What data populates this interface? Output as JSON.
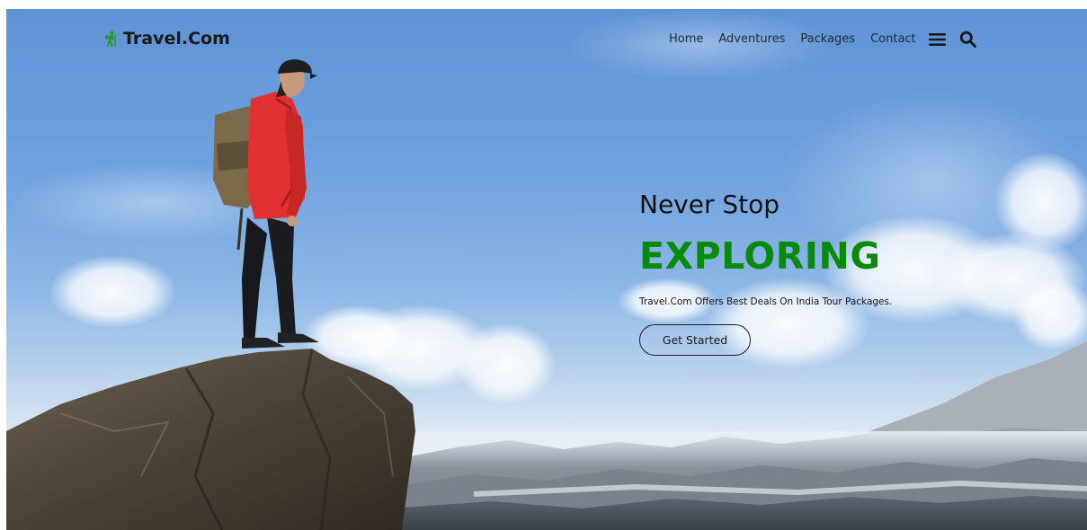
{
  "brand": {
    "name": "Travel.Com",
    "icon": "hiker-icon",
    "icon_color": "#1f9d1f"
  },
  "nav": {
    "items": [
      {
        "label": "Home"
      },
      {
        "label": "Adventures"
      },
      {
        "label": "Packages"
      },
      {
        "label": "Contact"
      }
    ],
    "menu_icon": "hamburger-icon",
    "search_icon": "search-icon"
  },
  "hero": {
    "subtitle": "Never Stop",
    "title": "EXPLORING",
    "description": "Travel.Com Offers Best Deals On India Tour Packages.",
    "cta_label": "Get Started"
  },
  "colors": {
    "accent": "#0a8a0a",
    "text": "#111111",
    "sky": "#6ea1df"
  }
}
